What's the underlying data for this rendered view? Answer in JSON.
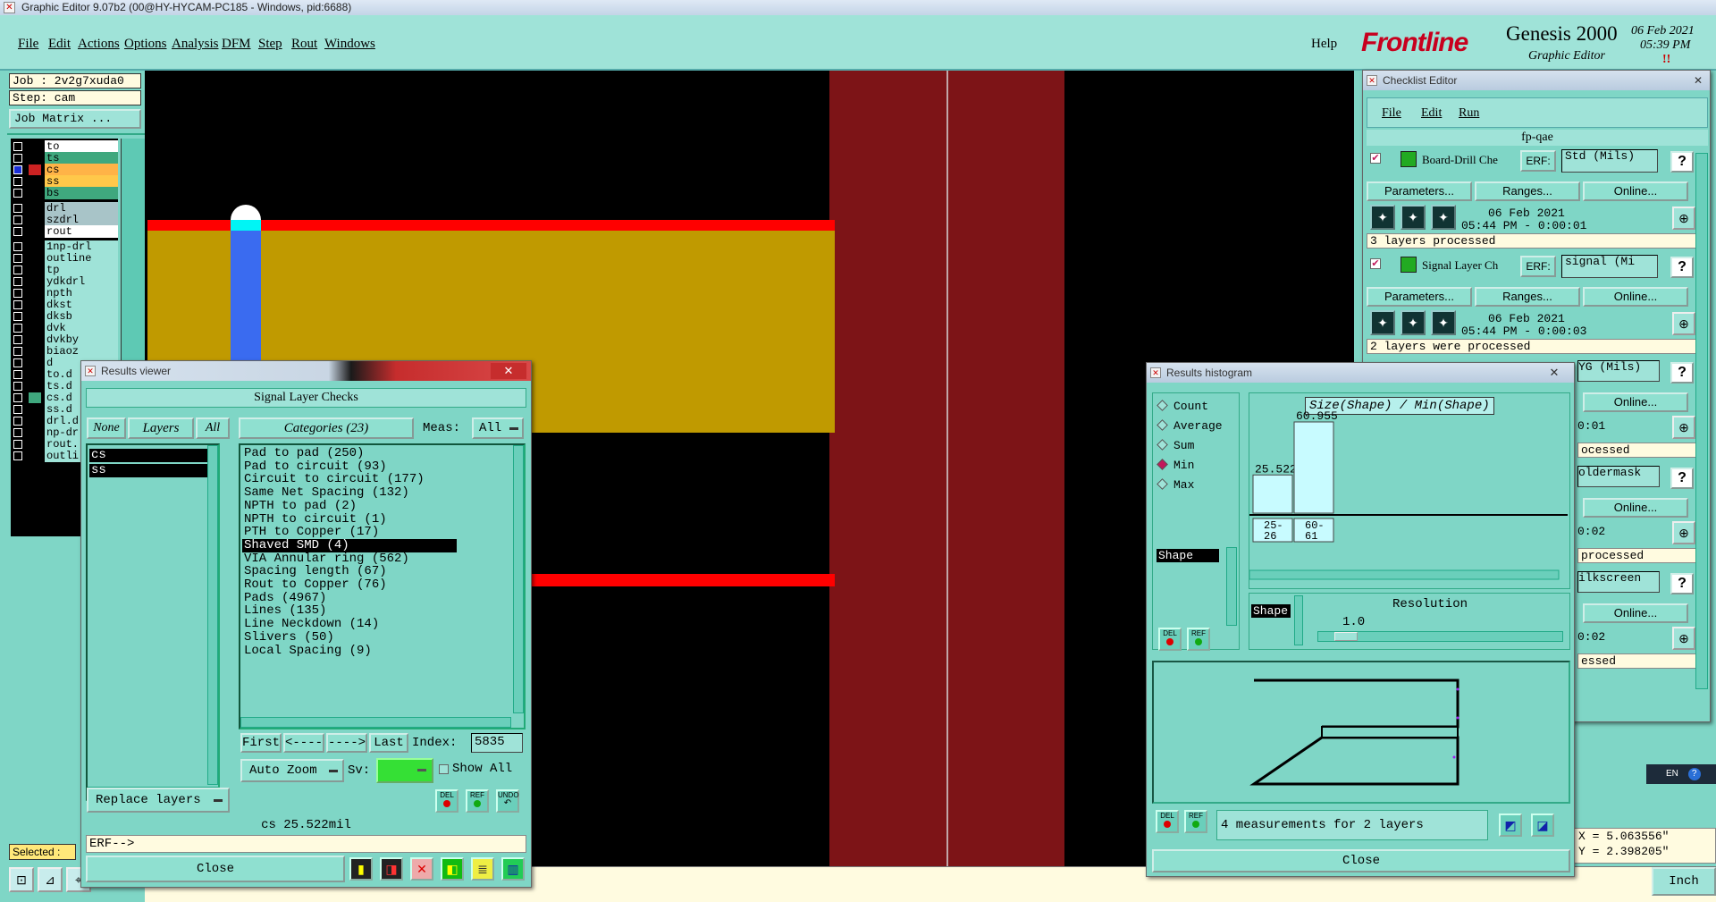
{
  "window_title": "Graphic Editor 9.07b2 (00@HY-HYCAM-PC185 - Windows, pid:6688)",
  "menu": [
    "File",
    "Edit",
    "Actions",
    "Options",
    "Analysis",
    "DFM",
    "Step",
    "Rout",
    "Windows"
  ],
  "help_label": "Help",
  "logo": {
    "brand": "Frontline",
    "product": "Genesis 2000",
    "subtitle": "Graphic Editor",
    "date": "06 Feb 2021",
    "time": "05:39 PM",
    "extra": "!!"
  },
  "job": {
    "job_label": "Job : 2v2g7xuda0",
    "step_label": "Step: cam",
    "matrix_button": "Job Matrix ..."
  },
  "layers": [
    {
      "name": "to",
      "color": "#ffffff",
      "mark": "#000000"
    },
    {
      "name": "ts",
      "color": "#3fa87e",
      "mark": "#000000"
    },
    {
      "name": "cs",
      "color": "#ffb347",
      "mark": "#cc2222",
      "active": true
    },
    {
      "name": "ss",
      "color": "#ffc84a",
      "mark": "#000000"
    },
    {
      "name": "bs",
      "color": "#3fa87e",
      "mark": "#000000"
    },
    {
      "name": "drl",
      "color": "#a8c4c8",
      "mark": "#000000"
    },
    {
      "name": "szdrl",
      "color": "#a8c4c8",
      "mark": "#000000"
    },
    {
      "name": "rout",
      "color": "#ffffff",
      "mark": "#000000"
    },
    {
      "name": "1np-drl",
      "color": "#9fe3d8",
      "mark": "#000000"
    },
    {
      "name": "outline",
      "color": "#9fe3d8",
      "mark": "#000000"
    },
    {
      "name": "tp",
      "color": "#9fe3d8",
      "mark": "#000000"
    },
    {
      "name": "ydkdrl",
      "color": "#9fe3d8",
      "mark": "#000000"
    },
    {
      "name": "npth",
      "color": "#9fe3d8",
      "mark": "#000000"
    },
    {
      "name": "dkst",
      "color": "#9fe3d8",
      "mark": "#000000"
    },
    {
      "name": "dksb",
      "color": "#9fe3d8",
      "mark": "#000000"
    },
    {
      "name": "dvk",
      "color": "#9fe3d8",
      "mark": "#000000"
    },
    {
      "name": "dvkby",
      "color": "#9fe3d8",
      "mark": "#000000"
    },
    {
      "name": "biaoz",
      "color": "#9fe3d8",
      "mark": "#000000"
    },
    {
      "name": "d",
      "color": "#9fe3d8",
      "mark": "#000000"
    },
    {
      "name": "to.d",
      "color": "#9fe3d8",
      "mark": "#000000"
    },
    {
      "name": "ts.d",
      "color": "#9fe3d8",
      "mark": "#000000"
    },
    {
      "name": "cs.d",
      "color": "#9fe3d8",
      "mark": "#3fa87e"
    },
    {
      "name": "ss.d",
      "color": "#9fe3d8",
      "mark": "#000000"
    },
    {
      "name": "drl.d",
      "color": "#9fe3d8",
      "mark": "#000000"
    },
    {
      "name": "np-dr",
      "color": "#9fe3d8",
      "mark": "#000000"
    },
    {
      "name": "rout.",
      "color": "#9fe3d8",
      "mark": "#000000"
    },
    {
      "name": "outli",
      "color": "#9fe3d8",
      "mark": "#000000"
    }
  ],
  "selected_label": "Selected :",
  "results_viewer": {
    "title": "Results viewer",
    "header": "Signal Layer Checks",
    "none_btn": "None",
    "layers_btn": "Layers",
    "all_btn": "All",
    "categories_btn": "Categories (23)",
    "meas_label": "Meas:",
    "meas_value": "All",
    "layer_items": [
      "cs",
      "ss"
    ],
    "categories": [
      "Pad to pad (250)",
      "Pad to circuit (93)",
      "Circuit to circuit (177)",
      "Same Net Spacing (132)",
      "NPTH to pad (2)",
      "NPTH to circuit (1)",
      "PTH to Copper (17)",
      "Shaved SMD (4)",
      "VIA Annular ring (562)",
      "Spacing length (67)",
      "Rout to Copper (76)",
      "Pads (4967)",
      "Lines (135)",
      "Line Neckdown (14)",
      "Slivers (50)",
      "Local Spacing (9)"
    ],
    "selected_category": "Shaved SMD (4)",
    "nav": {
      "first": "First",
      "prev": "<----",
      "next": "---->",
      "last": "Last",
      "index_label": "Index:",
      "index_value": "5835"
    },
    "auto_zoom": "Auto Zoom",
    "sv_label": "Sv:",
    "show_all": "Show All",
    "replace_layers": "Replace layers",
    "status": "cs 25.522mil",
    "erf": "ERF-->",
    "close": "Close",
    "del": "DEL",
    "ref": "REF",
    "undo": "UNDO"
  },
  "checklist": {
    "title": "Checklist Editor",
    "menu": [
      "File",
      "Edit",
      "Run"
    ],
    "name": "fp-qae",
    "blocks": [
      {
        "title": "Board-Drill Che",
        "erf": "ERF:",
        "units": "Std (Mils)",
        "date": "06 Feb 2021",
        "time": "05:44 PM - 0:00:01",
        "status": "3 layers processed",
        "flag": "#e0202a"
      },
      {
        "title": "Signal Layer Ch",
        "erf": "ERF:",
        "units": "signal (Mi",
        "date": "06 Feb 2021",
        "time": "05:44 PM - 0:00:03",
        "status": "2 layers were processed",
        "flag": "#e0202a"
      }
    ],
    "partial": [
      {
        "units": "YG (Mils)",
        "time": "0:01",
        "status": "ocessed",
        "flag": "#3fd23f"
      },
      {
        "units": "oldermask",
        "time": "0:02",
        "status": "processed",
        "flag": "#e0202a"
      },
      {
        "units": "ilkscreen",
        "time": "0:02",
        "status": "essed",
        "flag": "#e0202a"
      }
    ],
    "params_btn": "Parameters...",
    "ranges_btn": "Ranges...",
    "online_btn": "Online...",
    "help_btn": "?"
  },
  "histogram": {
    "title": "Results histogram",
    "options": [
      "Count",
      "Average",
      "Sum",
      "Min",
      "Max"
    ],
    "selected_option": "Min",
    "list_item": "Shape",
    "chart_title": "Size(Shape) / Min(Shape)",
    "bars": [
      {
        "label": "25.522",
        "range": "25-26",
        "value": 25.522
      },
      {
        "label": "60.955",
        "range": "60-61",
        "value": 60.955
      }
    ],
    "resolution_label": "Resolution",
    "resolution_value": "1.0",
    "shape_label": "Shape",
    "measurements": "4 measurements for 2 layers",
    "close": "Close",
    "del": "DEL",
    "ref": "REF"
  },
  "coords": {
    "x": "X = 5.063556\"",
    "y": "Y = 2.398205\""
  },
  "units_btn": "Inch",
  "lang": "EN",
  "lang_help": "?"
}
